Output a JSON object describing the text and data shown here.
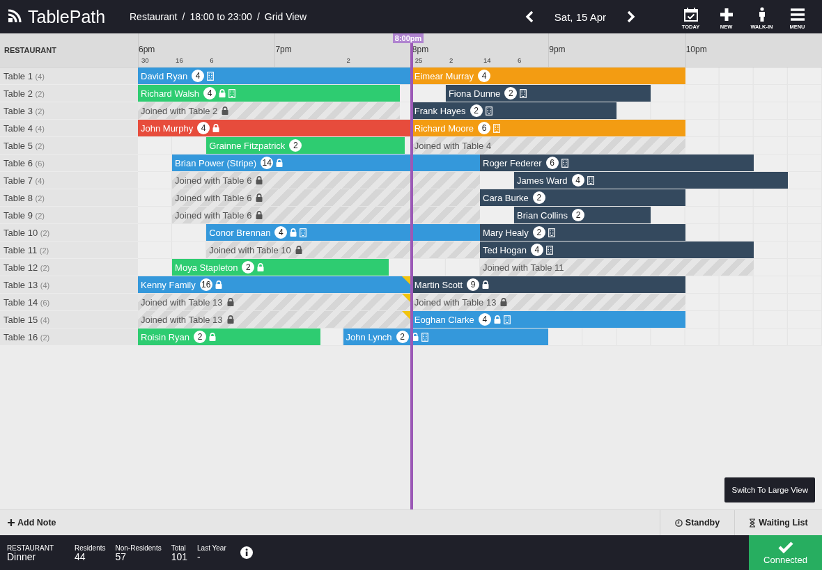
{
  "app": {
    "name": "TablePath"
  },
  "breadcrumbs": [
    {
      "label": "Restaurant"
    },
    {
      "label": "18:00 to 23:00"
    },
    {
      "label": "Grid View"
    }
  ],
  "breadcrumb_separator": "/",
  "date": "Sat, 15 Apr",
  "tools": [
    {
      "kind": "today",
      "label": "TODAY"
    },
    {
      "kind": "new",
      "label": "NEW"
    },
    {
      "kind": "walkin",
      "label": "WALK-IN"
    },
    {
      "kind": "menu",
      "label": "MENU"
    }
  ],
  "timeline": {
    "section": "RESTAURANT",
    "hours": [
      "6pm",
      "7pm",
      "8pm",
      "9pm",
      "10pm"
    ],
    "slot_counts": [
      "30",
      "16",
      "6",
      "2",
      "25",
      "2",
      "14",
      "6"
    ],
    "now": {
      "label": "8:00pm"
    }
  },
  "tables": [
    {
      "name": "Table 1",
      "capacity": "(4)",
      "bookings": [
        {
          "kind": "booking",
          "name": "David Ryan",
          "covers": "4",
          "color": "#3498db",
          "locked": false,
          "building": true
        },
        {
          "kind": "booking",
          "name": "Eimear Murray",
          "covers": "4",
          "color": "#f39c12",
          "locked": false,
          "building": false
        }
      ]
    },
    {
      "name": "Table 2",
      "capacity": "(2)",
      "bookings": [
        {
          "kind": "booking",
          "name": "Richard Walsh",
          "covers": "4",
          "color": "#2ecc71",
          "locked": true,
          "building": true
        },
        {
          "kind": "booking",
          "name": "Fiona Dunne",
          "covers": "2",
          "color": "#34495e",
          "locked": false,
          "building": true
        }
      ]
    },
    {
      "name": "Table 3",
      "capacity": "(2)",
      "bookings": [
        {
          "kind": "joined",
          "text": "Joined with Table 2",
          "locked": true
        },
        {
          "kind": "booking",
          "name": "Frank Hayes",
          "covers": "2",
          "color": "#34495e",
          "locked": false,
          "building": true
        }
      ]
    },
    {
      "name": "Table 4",
      "capacity": "(4)",
      "bookings": [
        {
          "kind": "booking",
          "name": "John Murphy",
          "covers": "4",
          "color": "#e74c3c",
          "locked": true,
          "building": false
        },
        {
          "kind": "booking",
          "name": "Richard Moore",
          "covers": "6",
          "color": "#f39c12",
          "locked": false,
          "building": true
        }
      ]
    },
    {
      "name": "Table 5",
      "capacity": "(2)",
      "bookings": [
        {
          "kind": "booking",
          "name": "Grainne Fitzpatrick",
          "covers": "2",
          "color": "#2ecc71",
          "locked": false,
          "building": false
        },
        {
          "kind": "joined",
          "text": "Joined with Table 4",
          "locked": false
        }
      ]
    },
    {
      "name": "Table 6",
      "capacity": "(6)",
      "bookings": [
        {
          "kind": "booking",
          "name": "Brian Power (Stripe)",
          "covers": "14",
          "color": "#3498db",
          "locked": true,
          "building": false
        },
        {
          "kind": "booking",
          "name": "Roger Federer",
          "covers": "6",
          "color": "#34495e",
          "locked": false,
          "building": true
        }
      ]
    },
    {
      "name": "Table 7",
      "capacity": "(4)",
      "bookings": [
        {
          "kind": "joined",
          "text": "Joined with Table 6",
          "locked": true
        },
        {
          "kind": "booking",
          "name": "James Ward",
          "covers": "4",
          "color": "#34495e",
          "locked": false,
          "building": true
        }
      ]
    },
    {
      "name": "Table 8",
      "capacity": "(2)",
      "bookings": [
        {
          "kind": "joined",
          "text": "Joined with Table 6",
          "locked": true
        },
        {
          "kind": "booking",
          "name": "Cara Burke",
          "covers": "2",
          "color": "#34495e",
          "locked": false,
          "building": false
        }
      ]
    },
    {
      "name": "Table 9",
      "capacity": "(2)",
      "bookings": [
        {
          "kind": "joined",
          "text": "Joined with Table 6",
          "locked": true
        },
        {
          "kind": "booking",
          "name": "Brian Collins",
          "covers": "2",
          "color": "#34495e",
          "locked": false,
          "building": false
        }
      ]
    },
    {
      "name": "Table 10",
      "capacity": "(2)",
      "bookings": [
        {
          "kind": "booking",
          "name": "Conor Brennan",
          "covers": "4",
          "color": "#3498db",
          "locked": true,
          "building": true
        },
        {
          "kind": "booking",
          "name": "Mary Healy",
          "covers": "2",
          "color": "#34495e",
          "locked": false,
          "building": true
        }
      ]
    },
    {
      "name": "Table 11",
      "capacity": "(2)",
      "bookings": [
        {
          "kind": "joined",
          "text": "Joined with Table 10",
          "locked": true
        },
        {
          "kind": "booking",
          "name": "Ted Hogan",
          "covers": "4",
          "color": "#34495e",
          "locked": false,
          "building": true
        }
      ]
    },
    {
      "name": "Table 12",
      "capacity": "(2)",
      "bookings": [
        {
          "kind": "booking",
          "name": "Moya Stapleton",
          "covers": "2",
          "color": "#2ecc71",
          "locked": true,
          "building": false
        },
        {
          "kind": "joined",
          "text": "Joined with Table 11",
          "locked": false
        }
      ]
    },
    {
      "name": "Table 13",
      "capacity": "(4)",
      "bookings": [
        {
          "kind": "booking",
          "name": "Kenny Family",
          "covers": "16",
          "color": "#3498db",
          "locked": true,
          "building": false,
          "flagged": true
        },
        {
          "kind": "booking",
          "name": "Martin Scott",
          "covers": "9",
          "color": "#34495e",
          "locked": true,
          "building": false
        }
      ]
    },
    {
      "name": "Table 14",
      "capacity": "(6)",
      "bookings": [
        {
          "kind": "joined",
          "text": "Joined with Table 13",
          "locked": true,
          "flagged": true
        },
        {
          "kind": "joined",
          "text": "Joined with Table 13",
          "locked": true
        }
      ]
    },
    {
      "name": "Table 15",
      "capacity": "(4)",
      "bookings": [
        {
          "kind": "joined",
          "text": "Joined with Table 13",
          "locked": true,
          "flagged": true
        },
        {
          "kind": "booking",
          "name": "Eoghan Clarke",
          "covers": "4",
          "color": "#3498db",
          "locked": true,
          "building": true
        }
      ]
    },
    {
      "name": "Table 16",
      "capacity": "(2)",
      "bookings": [
        {
          "kind": "booking",
          "name": "Roisin Ryan",
          "covers": "2",
          "color": "#2ecc71",
          "locked": true,
          "building": false
        },
        {
          "kind": "booking",
          "name": "John Lynch",
          "covers": "2",
          "color": "#3498db",
          "locked": true,
          "building": true
        }
      ]
    }
  ],
  "switch_view_button": "Switch To Large View",
  "toolbar": {
    "add_note": "Add Note",
    "standby": "Standby",
    "waiting_list": "Waiting List"
  },
  "footer": {
    "section": "RESTAURANT",
    "service": "Dinner",
    "stats": [
      {
        "label": "Residents",
        "value": "44"
      },
      {
        "label": "Non-Residents",
        "value": "57"
      },
      {
        "label": "Total",
        "value": "101"
      },
      {
        "label": "Last Year",
        "value": "-"
      }
    ],
    "status": "Connected"
  }
}
